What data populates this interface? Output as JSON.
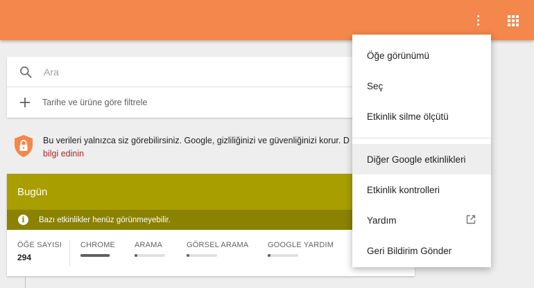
{
  "colors": {
    "topbar": "#f4874b",
    "today_header": "#a89e00",
    "today_notice": "#8a8200",
    "link": "#a52a2a",
    "shield": "#f4874b"
  },
  "topbar": {
    "more_icon": "more-vert-icon",
    "apps_icon": "apps-grid-icon"
  },
  "search": {
    "placeholder": "Ara",
    "icon": "search-icon"
  },
  "filter": {
    "label": "Tarihe ve ürüne göre filtrele",
    "icon": "plus-icon"
  },
  "privacy": {
    "text": "Bu verileri yalnızca siz görebilirsiniz. Google, gizliliğinizi ve güvenliğinizi korur. D",
    "link": "bilgi edinin",
    "icon": "shield-lock-icon"
  },
  "today": {
    "title": "Bugün",
    "notice": "Bazı etkinlikler henüz görünmeyebilir.",
    "info_icon": "info-icon",
    "stats": [
      {
        "label": "ÖĞE SAYISI",
        "value": "294"
      },
      {
        "label": "CHROME",
        "fill": 0.95
      },
      {
        "label": "ARAMA",
        "fill": 0.08
      },
      {
        "label": "GÖRSEL ARAMA",
        "fill": 0.08
      },
      {
        "label": "GOOGLE YARDIM",
        "fill": 0.08
      }
    ]
  },
  "menu": {
    "items": [
      {
        "label": "Öğe görünümü"
      },
      {
        "label": "Seç"
      },
      {
        "label": "Etkinlik silme ölçütü"
      },
      {
        "label": "Diğer Google etkinlikleri",
        "active": true
      },
      {
        "label": "Etkinlik kontrolleri"
      },
      {
        "label": "Yardım",
        "icon": "open-in-new-icon"
      },
      {
        "label": "Geri Bildirim Gönder"
      }
    ]
  }
}
